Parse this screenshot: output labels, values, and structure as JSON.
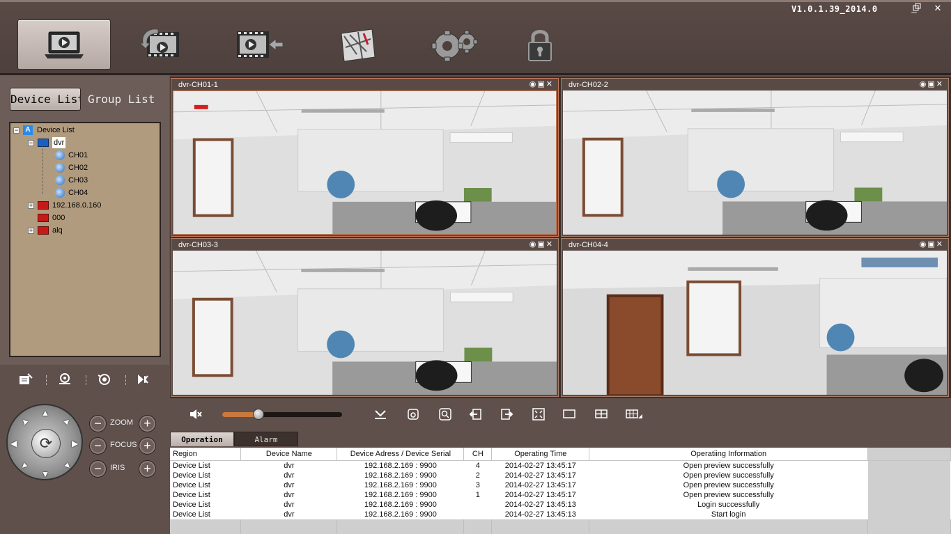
{
  "app": {
    "version": "V1.0.1.39_2014.0",
    "window_controls": [
      "minimize-icon",
      "restore-icon",
      "close-icon"
    ]
  },
  "toolbar": {
    "buttons": [
      {
        "name": "live-preview-button",
        "icon": "laptop-play-icon",
        "active": true
      },
      {
        "name": "playback-button",
        "icon": "film-play-in-icon",
        "active": false
      },
      {
        "name": "remote-playback-button",
        "icon": "film-play-out-icon",
        "active": false
      },
      {
        "name": "emap-button",
        "icon": "map-icon",
        "active": false
      },
      {
        "name": "settings-button",
        "icon": "gears-icon",
        "active": false
      },
      {
        "name": "lock-button",
        "icon": "lock-icon",
        "active": false
      }
    ]
  },
  "sidebar": {
    "tab_device": "Device List",
    "tab_group": "Group List",
    "tree": {
      "root": "Device List",
      "dvr": "dvr",
      "channels": [
        "CH01",
        "CH02",
        "CH03",
        "CH04"
      ],
      "device2": "192.168.0.160",
      "device3": "000",
      "device4": "alq"
    }
  },
  "ptz": {
    "tools": [
      "preset-icon",
      "cruise-icon",
      "track-icon",
      "auto-scan-icon"
    ],
    "zoom_label": "ZOOM",
    "focus_label": "FOCUS",
    "iris_label": "IRIS"
  },
  "video": {
    "panes": [
      {
        "title": "dvr-CH01-1"
      },
      {
        "title": "dvr-CH02-2"
      },
      {
        "title": "dvr-CH03-3"
      },
      {
        "title": "dvr-CH04-4"
      }
    ],
    "pane_icons": [
      "record-icon",
      "snapshot-icon",
      "close-icon"
    ]
  },
  "controls": {
    "volume": 0.3,
    "icons": [
      "mute-icon",
      "download-icon",
      "record-icon",
      "zoom-icon",
      "import-icon",
      "export-icon",
      "fullscreen-icon",
      "single-view-icon",
      "quad-view-icon",
      "layout-menu-icon"
    ]
  },
  "log": {
    "tab_operation": "Operation",
    "tab_alarm": "Alarm",
    "columns": [
      "Region",
      "Device Name",
      "Device Adress / Device Serial",
      "CH",
      "Operating Time",
      "Operatiing Information"
    ],
    "rows": [
      [
        "Device List",
        "dvr",
        "192.168.2.169 : 9900",
        "4",
        "2014-02-27 13:45:17",
        "Open preview successfully"
      ],
      [
        "Device List",
        "dvr",
        "192.168.2.169 : 9900",
        "2",
        "2014-02-27 13:45:17",
        "Open preview successfully"
      ],
      [
        "Device List",
        "dvr",
        "192.168.2.169 : 9900",
        "3",
        "2014-02-27 13:45:17",
        "Open preview successfully"
      ],
      [
        "Device List",
        "dvr",
        "192.168.2.169 : 9900",
        "1",
        "2014-02-27 13:45:17",
        "Open preview successfully"
      ],
      [
        "Device List",
        "dvr",
        "192.168.2.169 : 9900",
        "",
        "2014-02-27 13:45:13",
        "Login successfully"
      ],
      [
        "Device List",
        "dvr",
        "192.168.2.169 : 9900",
        "",
        "2014-02-27 13:45:13",
        "Start login"
      ]
    ]
  }
}
